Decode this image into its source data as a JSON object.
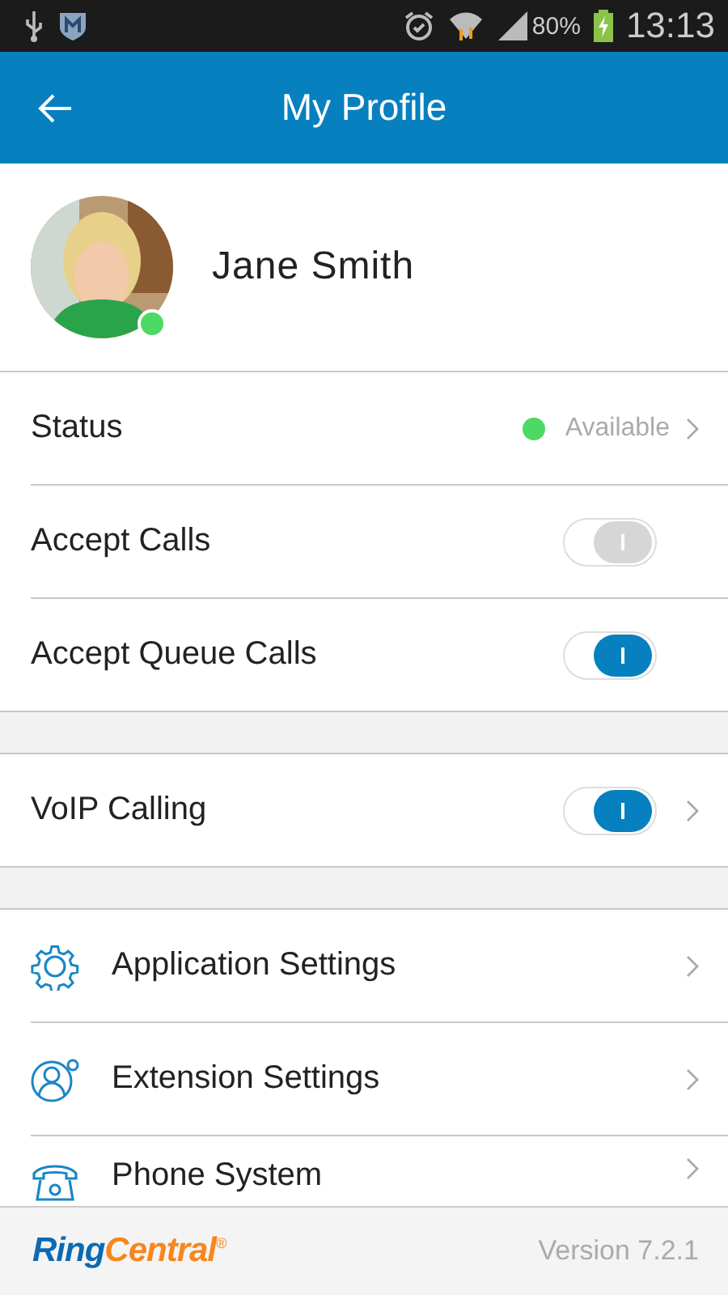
{
  "status_bar": {
    "battery": "80%",
    "time": "13:13"
  },
  "app_bar": {
    "title": "My Profile"
  },
  "profile": {
    "name": "Jane Smith"
  },
  "sections": [
    {
      "rows": [
        {
          "kind": "status",
          "label": "Status",
          "value": "Available",
          "color": "#4cd964"
        },
        {
          "kind": "toggle",
          "label": "Accept Calls",
          "on": false,
          "chevron": false
        },
        {
          "kind": "toggle",
          "label": "Accept Queue Calls",
          "on": true,
          "chevron": false
        }
      ]
    },
    {
      "rows": [
        {
          "kind": "toggle",
          "label": "VoIP Calling",
          "on": true,
          "chevron": true
        }
      ]
    },
    {
      "rows": [
        {
          "kind": "link",
          "label": "Application Settings"
        },
        {
          "kind": "link",
          "label": "Extension Settings"
        },
        {
          "kind": "link",
          "label": "Phone System"
        }
      ]
    }
  ],
  "footer": {
    "logo": {
      "first": "Ring",
      "second": "Central",
      "mark": "®"
    },
    "version": "Version 7.2.1"
  }
}
